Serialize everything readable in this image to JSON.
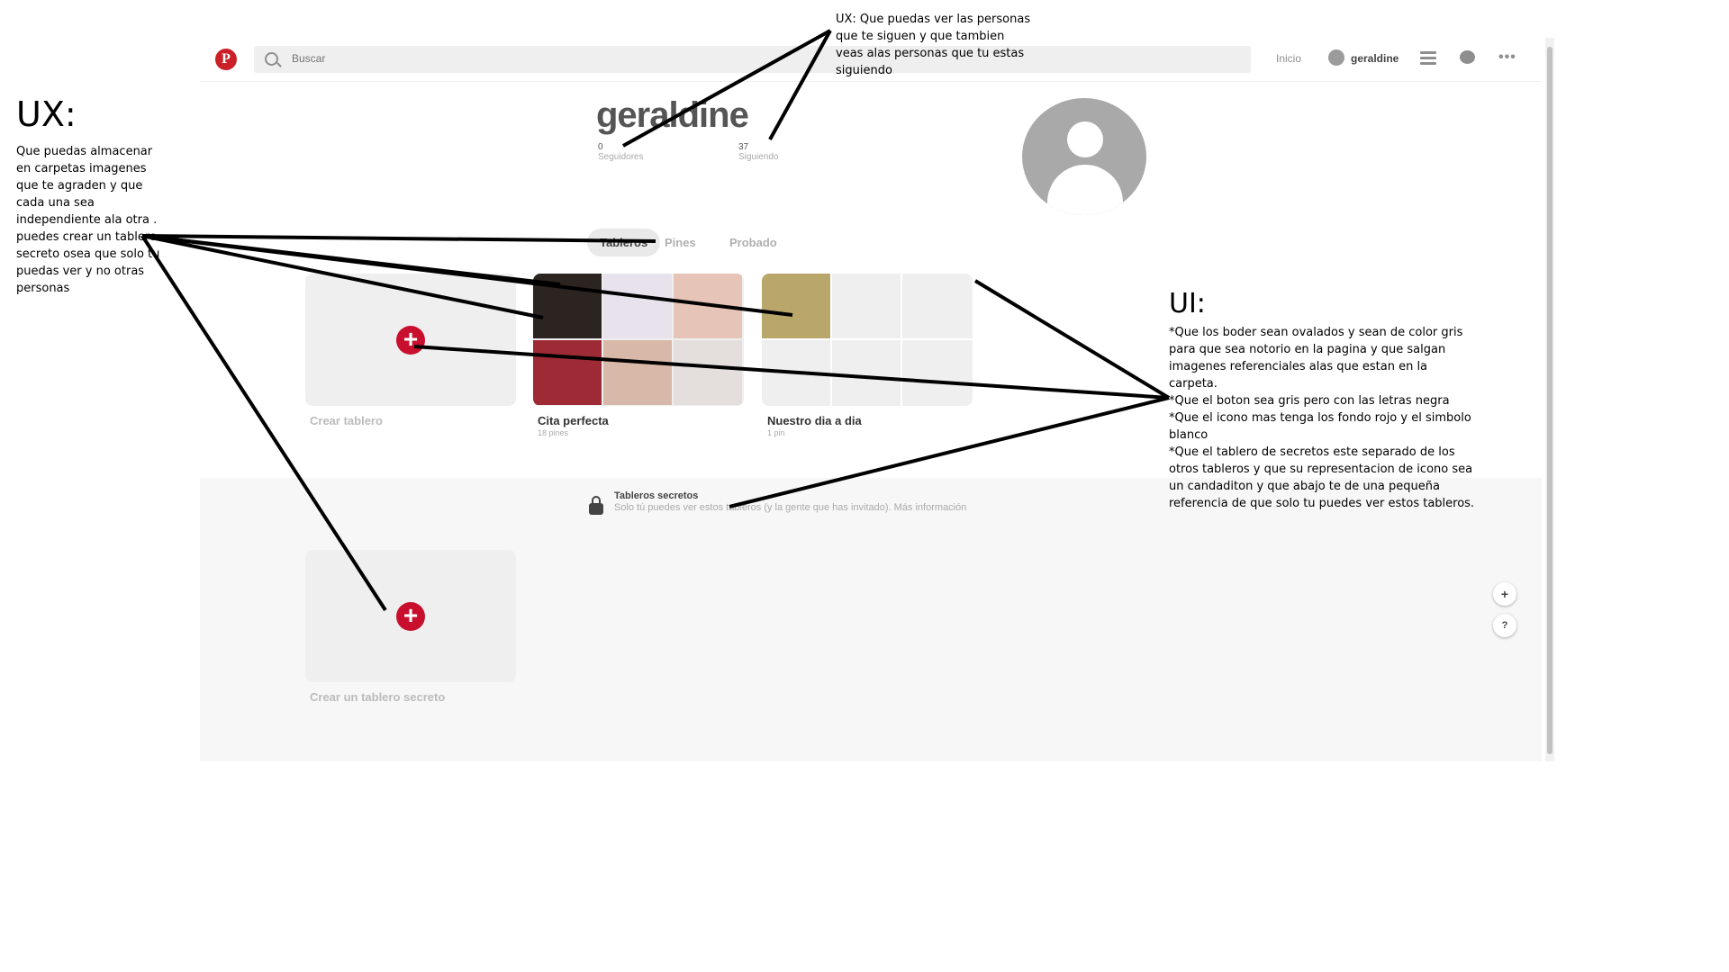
{
  "colors": {
    "brand": "#cb2027",
    "plus": "#c8102e"
  },
  "header": {
    "search_placeholder": "Buscar",
    "home_label": "Inicio",
    "username": "geraldine"
  },
  "profile": {
    "name": "geraldine",
    "followers_count": "0",
    "followers_label": "Seguidores",
    "following_count": "37",
    "following_label": "Siguiendo"
  },
  "tabs": [
    "Tableros",
    "Pines",
    "Probado"
  ],
  "boards": {
    "create_label": "Crear tablero",
    "cita_title": "Cita perfecta",
    "cita_count": "18 pines",
    "nuestro_title": "Nuestro dia a dia",
    "nuestro_count": "1 pin"
  },
  "secret": {
    "title": "Tableros secretos",
    "description": "Solo tú puedes ver estos tableros (y la gente que has invitado). Más información",
    "create_label": "Crear un tablero secreto"
  },
  "float_buttons": {
    "add": "+",
    "help": "?"
  },
  "annotations": {
    "ux_top": "UX: Que puedas ver las personas que te siguen y que tambien veas alas personas que tu estas siguiendo",
    "ux_left_heading": "UX:",
    "ux_left": "Que puedas almacenar en carpetas imagenes que te agraden y que cada una sea independiente ala otra . puedes crear un tablero secreto osea que solo tu puedas ver y no otras personas",
    "ui_heading": "UI:",
    "ui_body": "*Que los boder sean ovalados y sean de color gris para que sea notorio en la pagina y que salgan imagenes referenciales alas que estan en la carpeta.\n*Que el boton sea gris pero con las letras negra\n*Que el icono mas tenga los fondo rojo y el simbolo blanco\n*Que el tablero de secretos este separado de los otros tableros y que su representacion de icono sea un candaditon y que abajo te de una pequeña referencia de que solo tu puedes ver estos tableros."
  }
}
